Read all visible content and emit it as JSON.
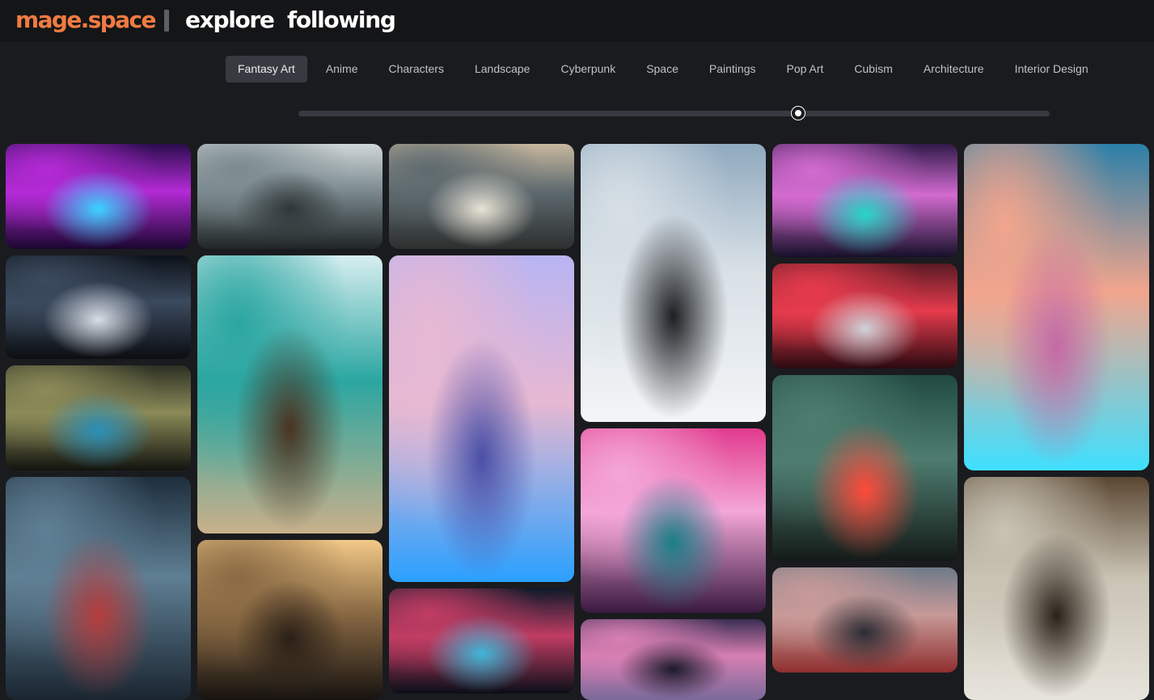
{
  "header": {
    "brand": "mage.space",
    "nav": [
      {
        "id": "explore",
        "label": "explore"
      },
      {
        "id": "following",
        "label": "following"
      }
    ]
  },
  "categories": {
    "active": "Fantasy Art",
    "items": [
      "Fantasy Art",
      "Anime",
      "Characters",
      "Landscape",
      "Cyberpunk",
      "Space",
      "Paintings",
      "Pop Art",
      "Cubism",
      "Architecture",
      "Interior Design"
    ]
  },
  "slider": {
    "value": 0.665
  },
  "colors": {
    "brand": "#f07b42",
    "background": "#1a1b1e",
    "header": "#141517",
    "tab_active": "#373a40"
  },
  "gallery": {
    "columns": [
      [
        {
          "name": "neon-synthwave-room",
          "colors": [
            "#2a0d4e",
            "#b42ad6",
            "#3ad3ff",
            "#1a0630"
          ]
        },
        {
          "name": "alien-ufo-pods",
          "colors": [
            "#0c1118",
            "#3b4a5e",
            "#d9dee6",
            "#0b0e12"
          ]
        },
        {
          "name": "hover-car-swamp",
          "colors": [
            "#2c3024",
            "#8b8a58",
            "#2a8fb8",
            "#12140f"
          ]
        },
        {
          "name": "misty-spire-city",
          "colors": [
            "#1e2e3c",
            "#5f7f94",
            "#b43c3c",
            "#1a2530"
          ]
        }
      ],
      [
        {
          "name": "saucer-tower-skyline",
          "colors": [
            "#cfd6d8",
            "#7b8a8f",
            "#2f3638",
            "#202526"
          ]
        },
        {
          "name": "retro-pinup-bridge",
          "colors": [
            "#d7eef0",
            "#2ba6a1",
            "#4a3322",
            "#c9b08a"
          ]
        },
        {
          "name": "gothic-dark-tower",
          "colors": [
            "#f2c987",
            "#8a6a44",
            "#2a2017",
            "#171310"
          ]
        }
      ],
      [
        {
          "name": "desert-sports-car",
          "colors": [
            "#c8b89e",
            "#5e6a6f",
            "#e8e3d6",
            "#2c2f2e"
          ]
        },
        {
          "name": "crystal-egg-fortress",
          "colors": [
            "#b7b4f2",
            "#e7b8d2",
            "#4a4fa6",
            "#2aa0ff"
          ]
        },
        {
          "name": "rainy-neon-street",
          "colors": [
            "#0e1a2a",
            "#c13c63",
            "#3fb6d8",
            "#0a0f18"
          ]
        }
      ],
      [
        {
          "name": "monolith-snow-tower",
          "colors": [
            "#8fa9be",
            "#d8e0e6",
            "#1d1f22",
            "#f3f5f7"
          ]
        },
        {
          "name": "pink-mirror-hallway",
          "colors": [
            "#e13a8c",
            "#f4a6d8",
            "#1a7e86",
            "#3a1a40"
          ]
        },
        {
          "name": "misty-neon-canyon",
          "colors": [
            "#3a2e52",
            "#d77fb3",
            "#1b1a2a",
            "#7a6a9a"
          ]
        }
      ],
      [
        {
          "name": "cyber-city-bots",
          "colors": [
            "#301a4a",
            "#d36bd0",
            "#27d6c6",
            "#16102a"
          ]
        },
        {
          "name": "red-hover-racer",
          "colors": [
            "#5a1a24",
            "#e63b4c",
            "#cfd2d8",
            "#2a0a10"
          ]
        },
        {
          "name": "saucer-vehicle-green",
          "colors": [
            "#214a42",
            "#4e7d6f",
            "#ff4a3a",
            "#141a18"
          ]
        },
        {
          "name": "hazy-skyline-dusk",
          "colors": [
            "#6e7a88",
            "#c79a98",
            "#2b2d34",
            "#8f2f2f"
          ]
        }
      ],
      [
        {
          "name": "floating-island-portal",
          "colors": [
            "#2b7fa8",
            "#f2a58d",
            "#c46aa6",
            "#3ee0ff"
          ]
        },
        {
          "name": "construction-bridge-arch",
          "colors": [
            "#5a4632",
            "#c9c3b4",
            "#2a2118",
            "#e7e4dc"
          ]
        }
      ]
    ]
  }
}
